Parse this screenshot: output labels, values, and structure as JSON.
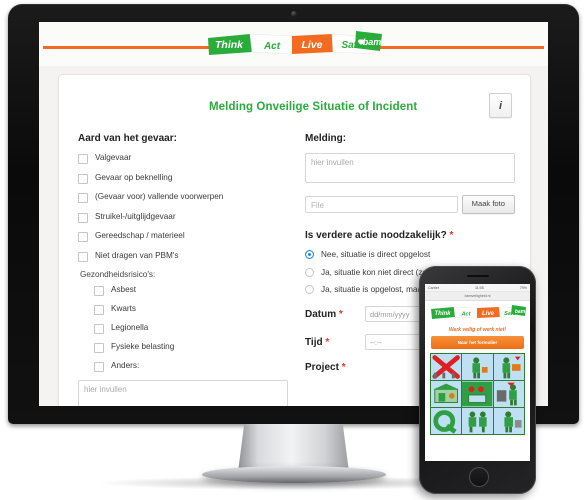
{
  "logo": {
    "words": [
      "Think",
      "Act",
      "Live",
      "Safe"
    ],
    "brand": "bam",
    "colors": {
      "green": "#2aac3b",
      "orange": "#f26b21",
      "white": "#ffffff"
    }
  },
  "form": {
    "title": "Melding Onveilige Situatie of Incident",
    "info_button": "i",
    "hazard": {
      "heading": "Aard van het gevaar:",
      "options": [
        "Valgevaar",
        "Gevaar op beknelling",
        "(Gevaar voor) vallende voorwerpen",
        "Struikel-/uitglijdgevaar",
        "Gereedschap / materieel",
        "Niet dragen van PBM's"
      ]
    },
    "health": {
      "heading": "Gezondheidsrisico's:",
      "options": [
        "Asbest",
        "Kwarts",
        "Legionella",
        "Fysieke belasting",
        "Anders:"
      ],
      "other_placeholder": "hier invullen"
    },
    "report": {
      "heading": "Melding:",
      "placeholder": "hier invullen",
      "file_placeholder": "File",
      "photo_button": "Maak foto"
    },
    "action": {
      "question": "Is verdere actie noodzakelijk?",
      "required_mark": "*",
      "options": [
        {
          "label": "Nee, situatie is direct opgelost",
          "selected": true
        },
        {
          "label": "Ja, situatie kon niet direct (zelf) worden opgelost",
          "selected": false
        },
        {
          "label": "Ja, situatie is opgelost, maar verdere",
          "selected": false
        }
      ]
    },
    "fields": [
      {
        "label": "Datum",
        "required": "*",
        "placeholder": "dd/mm/yyyy"
      },
      {
        "label": "Tijd",
        "required": "*",
        "placeholder": "--:--"
      },
      {
        "label": "Project",
        "required": "*",
        "placeholder": ""
      }
    ]
  },
  "phone": {
    "status_left": "Carrier",
    "status_center": "11:05",
    "status_right": "79%",
    "url": "bamveiligheid.nl",
    "claim": "Werk veilig of werk niet!",
    "cta": "Naar het formulier"
  }
}
